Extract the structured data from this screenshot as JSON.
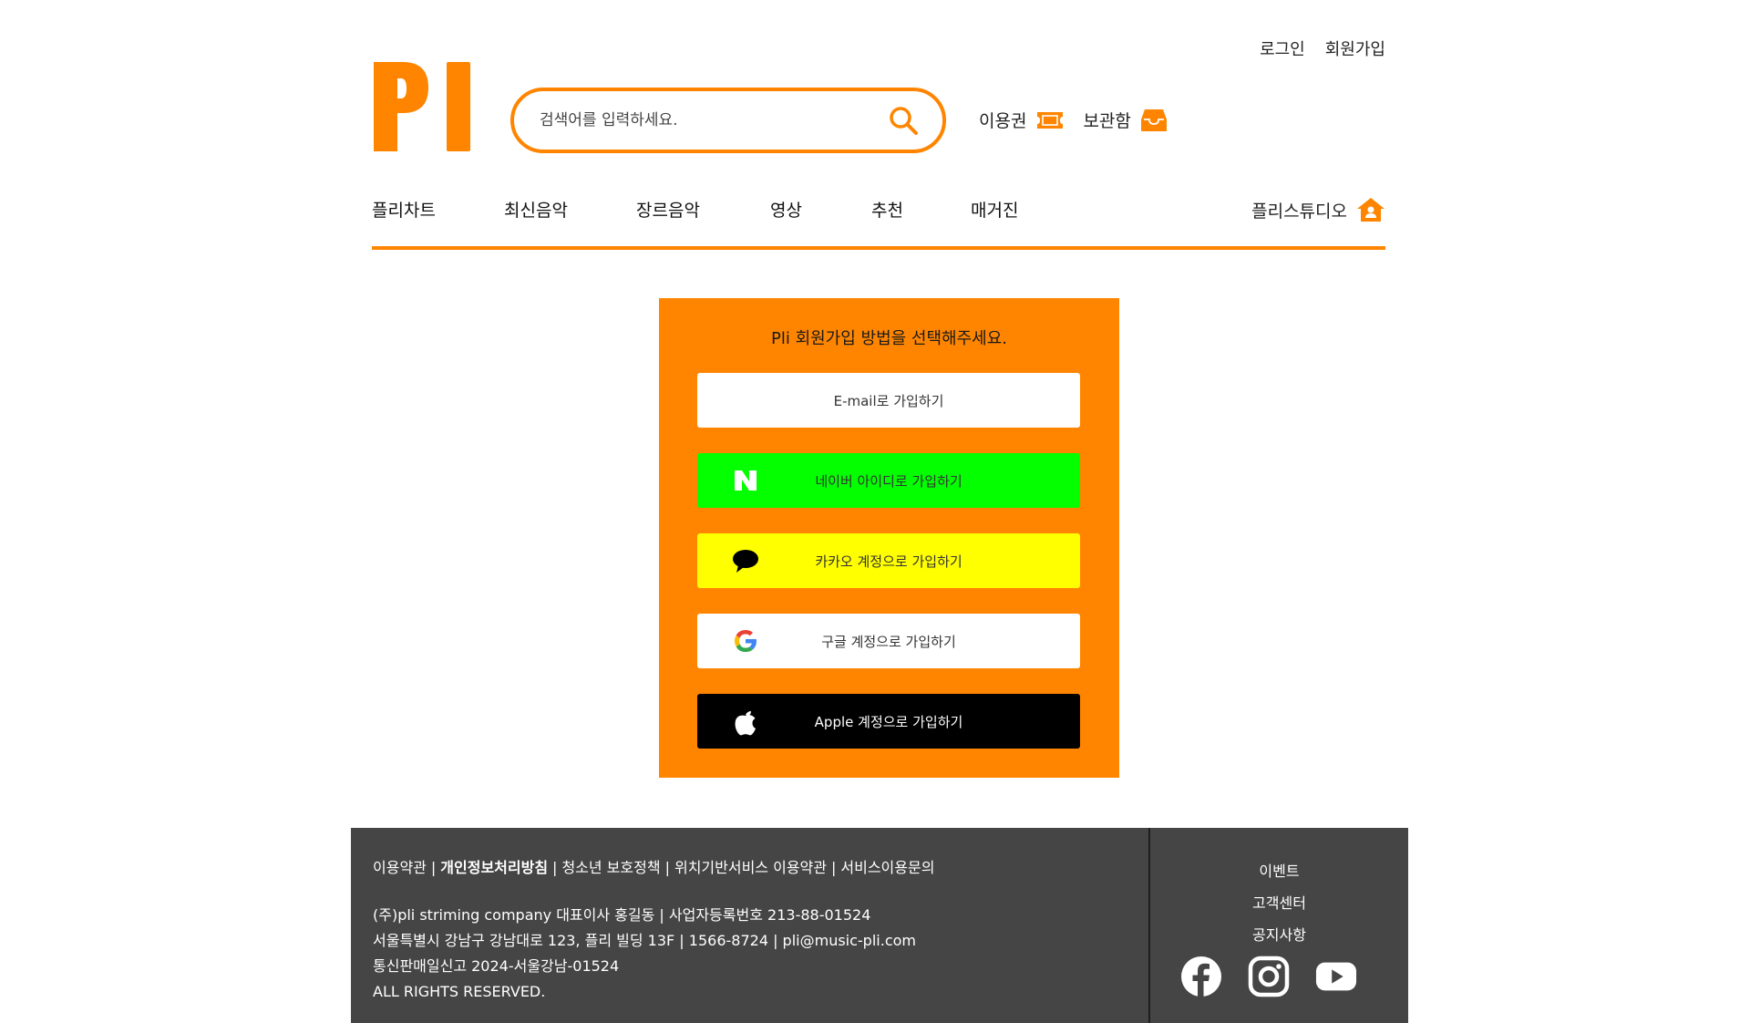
{
  "header": {
    "login": "로그인",
    "signup": "회원가입",
    "logo_text": "PI",
    "search_placeholder": "검색어를 입력하세요.",
    "ticket": "이용권",
    "storage": "보관함"
  },
  "nav": {
    "items": [
      "플리차트",
      "최신음악",
      "장르음악",
      "영상",
      "추천",
      "매거진"
    ],
    "studio": "플리스튜디오"
  },
  "signup_panel": {
    "title": "Pli 회원가입 방법을 선택해주세요.",
    "email": "E-mail로 가입하기",
    "naver": "네이버 아이디로 가입하기",
    "kakao": "카카오 계정으로 가입하기",
    "google": "구글 계정으로 가입하기",
    "apple": "Apple 계정으로 가입하기"
  },
  "footer": {
    "links": [
      "이용약관",
      "개인정보처리방침",
      "청소년 보호정책",
      "위치기반서비스 이용약관",
      "서비스이용문의"
    ],
    "company": "(주)pli striming company 대표이사 홍길동 | 사업자등록번호 213-88-01524",
    "address": "서울특별시 강남구 강남대로 123, 플리 빌딩 13F | 1566-8724 | pli@music-pli.com",
    "registration": "통신판매일신고 2024-서울강남-01524",
    "rights": "ALL RIGHTS RESERVED.",
    "right_links": [
      "이벤트",
      "고객센터",
      "공지사항"
    ]
  },
  "colors": {
    "accent": "#FF8500",
    "naver": "#03FF00",
    "kakao": "#FFFF00",
    "footer_bg": "#454545"
  },
  "icons": [
    "search-icon",
    "ticket-icon",
    "inbox-icon",
    "home-user-icon",
    "naver-icon",
    "kakao-chat-icon",
    "google-icon",
    "apple-icon",
    "facebook-icon",
    "instagram-icon",
    "youtube-icon"
  ]
}
